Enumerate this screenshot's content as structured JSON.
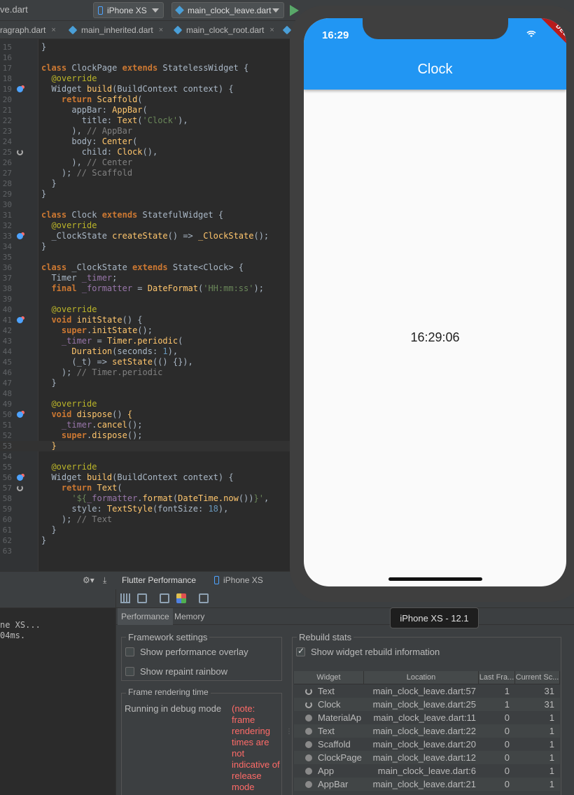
{
  "toolbar": {
    "open_file": "ve.dart",
    "device": "iPhone XS",
    "run_config": "main_clock_leave.dart"
  },
  "tabs": [
    {
      "label": "ragraph.dart",
      "active": false
    },
    {
      "label": "main_inherited.dart",
      "active": false
    },
    {
      "label": "main_clock_root.dart",
      "active": false
    }
  ],
  "tab_close": "×",
  "editor": {
    "lines": [
      {
        "n": "15",
        "gutter": "",
        "html": "<span class=\"ty\">}</span>"
      },
      {
        "n": "16",
        "gutter": "",
        "html": ""
      },
      {
        "n": "17",
        "gutter": "",
        "html": "<span class=\"kw\">class</span> ClockPage <span class=\"kw\">extends</span> StatelessWidget {"
      },
      {
        "n": "18",
        "gutter": "",
        "html": "  <span class=\"an\">@override</span>"
      },
      {
        "n": "19",
        "gutter": "override",
        "html": "  Widget <span class=\"fn\">build</span>(BuildContext context) {"
      },
      {
        "n": "20",
        "gutter": "",
        "html": "    <span class=\"kw\">return</span> <span class=\"fn\">Scaffold</span>("
      },
      {
        "n": "21",
        "gutter": "",
        "html": "      appBar: <span class=\"fn\">AppBar</span>("
      },
      {
        "n": "22",
        "gutter": "",
        "html": "        title: <span class=\"fn\">Text</span>(<span class=\"str\">'Clock'</span>),"
      },
      {
        "n": "23",
        "gutter": "",
        "html": "      ), <span class=\"cm\">// AppBar</span>"
      },
      {
        "n": "24",
        "gutter": "",
        "html": "      body: <span class=\"fn\">Center</span>("
      },
      {
        "n": "25",
        "gutter": "spin",
        "html": "        child: <span class=\"fn\">Clock</span>(),"
      },
      {
        "n": "26",
        "gutter": "",
        "html": "      ), <span class=\"cm\">// Center</span>"
      },
      {
        "n": "27",
        "gutter": "",
        "html": "    ); <span class=\"cm\">// Scaffold</span>"
      },
      {
        "n": "28",
        "gutter": "",
        "html": "  }"
      },
      {
        "n": "29",
        "gutter": "",
        "html": "}"
      },
      {
        "n": "30",
        "gutter": "",
        "html": ""
      },
      {
        "n": "31",
        "gutter": "",
        "html": "<span class=\"kw\">class</span> Clock <span class=\"kw\">extends</span> StatefulWidget {"
      },
      {
        "n": "32",
        "gutter": "",
        "html": "  <span class=\"an\">@override</span>"
      },
      {
        "n": "33",
        "gutter": "override",
        "html": "  _ClockState <span class=\"fn\">createState</span>() => <span class=\"fn\">_ClockState</span>();"
      },
      {
        "n": "34",
        "gutter": "",
        "html": "}"
      },
      {
        "n": "35",
        "gutter": "",
        "html": ""
      },
      {
        "n": "36",
        "gutter": "",
        "html": "<span class=\"kw\">class</span> _ClockState <span class=\"kw\">extends</span> State&lt;Clock&gt; {"
      },
      {
        "n": "37",
        "gutter": "",
        "html": "  Timer <span class=\"fld\">_timer</span>;"
      },
      {
        "n": "38",
        "gutter": "",
        "html": "  <span class=\"kw\">final</span> <span class=\"fld\">_formatter</span> = <span class=\"fn\">DateFormat</span>(<span class=\"str\">'HH:mm:ss'</span>);"
      },
      {
        "n": "39",
        "gutter": "",
        "html": ""
      },
      {
        "n": "40",
        "gutter": "",
        "html": "  <span class=\"an\">@override</span>"
      },
      {
        "n": "41",
        "gutter": "override",
        "html": "  <span class=\"kw\">void</span> <span class=\"fn\">initState</span>() {"
      },
      {
        "n": "42",
        "gutter": "",
        "html": "    <span class=\"kw\">super</span>.<span class=\"fn\">initState</span>();"
      },
      {
        "n": "43",
        "gutter": "",
        "html": "    <span class=\"fld\">_timer</span> = <span class=\"fn\">Timer.periodic</span>("
      },
      {
        "n": "44",
        "gutter": "",
        "html": "      <span class=\"fn\">Duration</span>(seconds: <span class=\"num\">1</span>),"
      },
      {
        "n": "45",
        "gutter": "",
        "html": "      (_t) => <span class=\"fn\">setState</span>(() {}),"
      },
      {
        "n": "46",
        "gutter": "",
        "html": "    ); <span class=\"cm\">// Timer.periodic</span>"
      },
      {
        "n": "47",
        "gutter": "",
        "html": "  }"
      },
      {
        "n": "48",
        "gutter": "",
        "html": ""
      },
      {
        "n": "49",
        "gutter": "",
        "html": "  <span class=\"an\">@override</span>"
      },
      {
        "n": "50",
        "gutter": "override",
        "html": "  <span class=\"kw\">void</span> <span class=\"fn\">dispose</span>() <span class=\"fn\">{</span>"
      },
      {
        "n": "51",
        "gutter": "",
        "html": "    <span class=\"fld\">_timer</span>.<span class=\"fn\">cancel</span>();"
      },
      {
        "n": "52",
        "gutter": "",
        "html": "    <span class=\"kw\">super</span>.<span class=\"fn\">dispose</span>();"
      },
      {
        "n": "53",
        "gutter": "",
        "html": "  <span class=\"fn\">}</span>"
      },
      {
        "n": "54",
        "gutter": "",
        "html": ""
      },
      {
        "n": "55",
        "gutter": "",
        "html": "  <span class=\"an\">@override</span>"
      },
      {
        "n": "56",
        "gutter": "override",
        "html": "  Widget <span class=\"fn\">build</span>(BuildContext context) {"
      },
      {
        "n": "57",
        "gutter": "spin",
        "html": "    <span class=\"kw\">return</span> <span class=\"fn\">Text</span>("
      },
      {
        "n": "58",
        "gutter": "",
        "html": "      <span class=\"str\">'${</span><span class=\"fld\">_formatter</span>.<span class=\"fn\">format</span>(<span class=\"fn\">DateTime.now</span>())<span class=\"str\">}'</span>,"
      },
      {
        "n": "59",
        "gutter": "",
        "html": "      style: <span class=\"fn\">TextStyle</span>(fontSize: <span class=\"num\">18</span>),"
      },
      {
        "n": "60",
        "gutter": "",
        "html": "    ); <span class=\"cm\">// Text</span>"
      },
      {
        "n": "61",
        "gutter": "",
        "html": "  }"
      },
      {
        "n": "62",
        "gutter": "",
        "html": "}"
      },
      {
        "n": "63",
        "gutter": "",
        "html": ""
      }
    ],
    "current_line": "53"
  },
  "toolstrip": {
    "flutter_performance": "Flutter Performance",
    "device_tab": "iPhone XS"
  },
  "console": {
    "text": "ne XS...\n04ms."
  },
  "perf": {
    "subtabs": [
      "Performance",
      "Memory"
    ],
    "framework_settings": {
      "title": "Framework settings",
      "show_perf_overlay": "Show performance overlay",
      "show_repaint_rainbow": "Show repaint rainbow"
    },
    "frame_rendering": {
      "title": "Frame rendering time",
      "running_label": "Running in debug mode",
      "note": "(note: frame rendering times are not indicative of release mode"
    },
    "rebuild_stats": {
      "title": "Rebuild stats",
      "show_rebuild": "Show widget rebuild information",
      "columns": [
        "Widget",
        "Location",
        "Last Fra...",
        "Current Sc..."
      ],
      "rows": [
        {
          "widget": "Text",
          "location": "main_clock_leave.dart:57",
          "last": "1",
          "current": "31",
          "spinning": true
        },
        {
          "widget": "Clock",
          "location": "main_clock_leave.dart:25",
          "last": "1",
          "current": "31",
          "spinning": true
        },
        {
          "widget": "MaterialAp",
          "location": "main_clock_leave.dart:11",
          "last": "0",
          "current": "1",
          "spinning": false
        },
        {
          "widget": "Text",
          "location": "main_clock_leave.dart:22",
          "last": "0",
          "current": "1",
          "spinning": false
        },
        {
          "widget": "Scaffold",
          "location": "main_clock_leave.dart:20",
          "last": "0",
          "current": "1",
          "spinning": false
        },
        {
          "widget": "ClockPage",
          "location": "main_clock_leave.dart:12",
          "last": "0",
          "current": "1",
          "spinning": false
        },
        {
          "widget": "App",
          "location": "main_clock_leave.dart:6",
          "last": "0",
          "current": "1",
          "spinning": false
        },
        {
          "widget": "AppBar",
          "location": "main_clock_leave.dart:21",
          "last": "0",
          "current": "1",
          "spinning": false
        }
      ]
    }
  },
  "simulator": {
    "status_time": "16:29",
    "appbar_title": "Clock",
    "clock_text": "16:29:06",
    "debug_banner": "DEBUG",
    "appbar_color": "#2196f3",
    "tooltip": "iPhone XS - 12.1"
  }
}
